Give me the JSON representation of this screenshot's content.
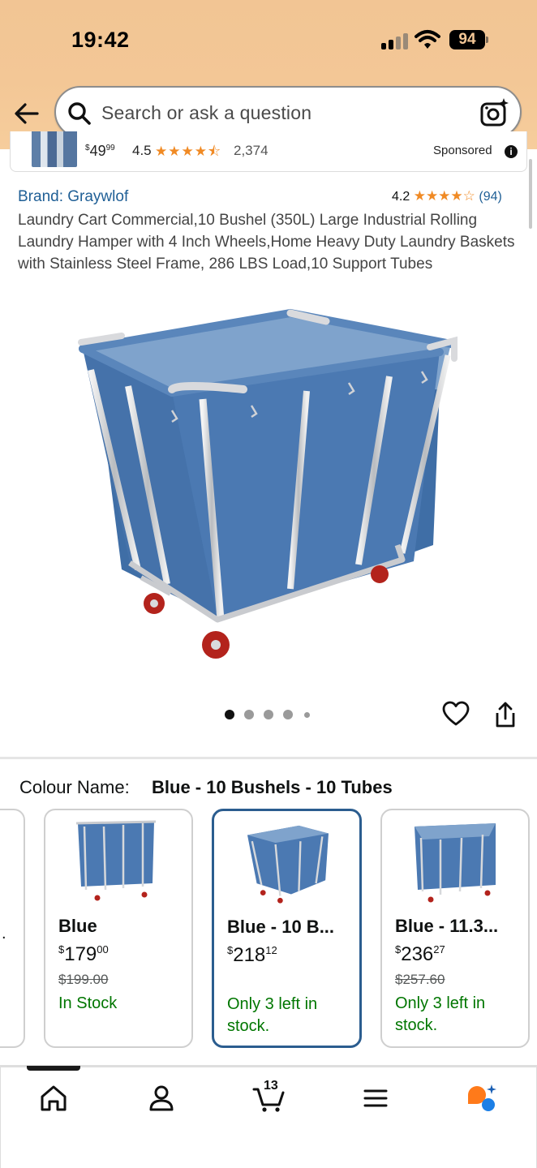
{
  "status_bar": {
    "time": "19:42",
    "battery": "94"
  },
  "search": {
    "placeholder": "Search or ask a question"
  },
  "sponsored_product": {
    "price_whole": "49",
    "price_fraction": "99",
    "rating": "4.5",
    "review_count": "2,374",
    "label": "Sponsored"
  },
  "product": {
    "brand": "Brand: Graywlof",
    "rating": "4.2",
    "rating_count": "(94)",
    "title": "Laundry Cart Commercial,10 Bushel (350L) Large Industrial Rolling Laundry Hamper with 4 Inch Wheels,Home Heavy Duty Laundry Baskets with Stainless Steel Frame, 286 LBS Load,10 Support Tubes",
    "image_count": 5,
    "active_image_index": 0
  },
  "colour": {
    "label": "Colour Name:",
    "selected": "Blue - 10 Bushels - 10 Tubes",
    "options": [
      {
        "name": "Blue",
        "currency": "$",
        "price_whole": "179",
        "price_fraction": "00",
        "list_price": "$199.00",
        "stock": "In Stock",
        "selected": false
      },
      {
        "name": "Blue - 10 B...",
        "currency": "$",
        "price_whole": "218",
        "price_fraction": "12",
        "list_price": "",
        "stock": "Only 3 left in stock.",
        "selected": true
      },
      {
        "name": "Blue - 11.3...",
        "currency": "$",
        "price_whole": "236",
        "price_fraction": "27",
        "list_price": "$257.60",
        "stock": "Only 3 left in stock.",
        "selected": false
      }
    ]
  },
  "bottom_nav": {
    "items": [
      "home-icon",
      "account-icon",
      "cart-icon",
      "menu-icon",
      "rufus-icon"
    ],
    "cart_count": "13",
    "active": "home"
  },
  "colors": {
    "header": "#f3c796",
    "link": "#1f5f96",
    "star": "#f08a24",
    "in_stock": "#007600",
    "selected_border": "#2b5d8f",
    "product_blue": "#4a78b0"
  }
}
